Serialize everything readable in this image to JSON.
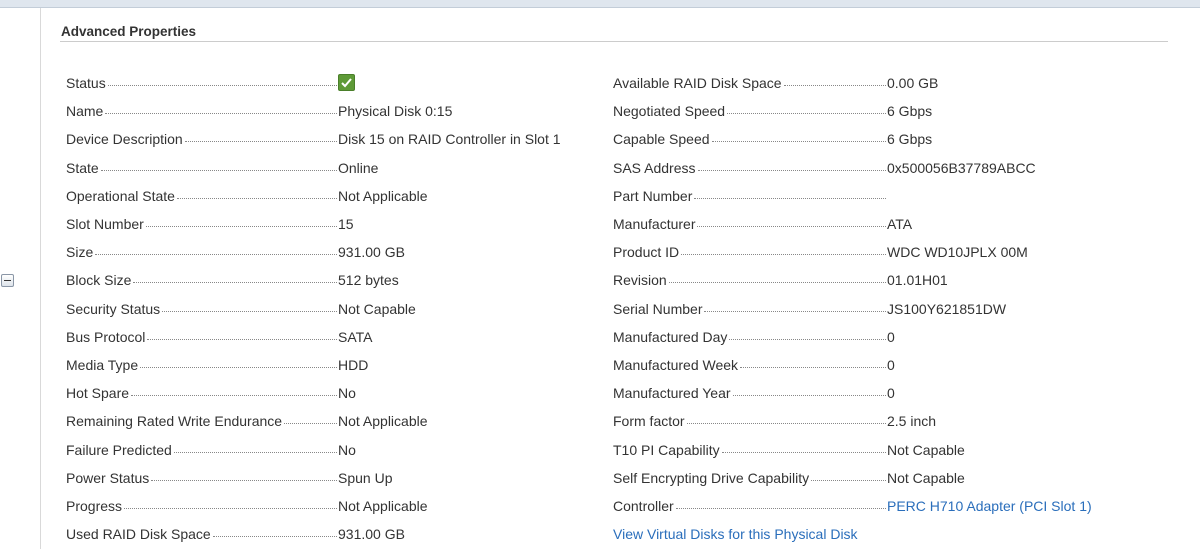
{
  "panel": {
    "title": "Advanced Properties"
  },
  "left": [
    {
      "label": "Status",
      "value": "",
      "status_icon": "check-icon",
      "status_color": "#5e9a37"
    },
    {
      "label": "Name",
      "value": "Physical Disk 0:15"
    },
    {
      "label": "Device Description",
      "value": "Disk 15 on RAID Controller in Slot 1"
    },
    {
      "label": "State",
      "value": "Online"
    },
    {
      "label": "Operational State",
      "value": "Not Applicable"
    },
    {
      "label": "Slot Number",
      "value": "15"
    },
    {
      "label": "Size",
      "value": "931.00 GB"
    },
    {
      "label": "Block Size",
      "value": "512 bytes"
    },
    {
      "label": "Security Status",
      "value": "Not Capable"
    },
    {
      "label": "Bus Protocol",
      "value": "SATA"
    },
    {
      "label": "Media Type",
      "value": "HDD"
    },
    {
      "label": "Hot Spare",
      "value": "No"
    },
    {
      "label": "Remaining Rated Write Endurance",
      "value": "Not Applicable"
    },
    {
      "label": "Failure Predicted",
      "value": "No"
    },
    {
      "label": "Power Status",
      "value": "Spun Up"
    },
    {
      "label": "Progress",
      "value": "Not Applicable"
    },
    {
      "label": "Used RAID Disk Space",
      "value": "931.00 GB"
    }
  ],
  "right": [
    {
      "label": "Available RAID Disk Space",
      "value": "0.00 GB"
    },
    {
      "label": "Negotiated Speed",
      "value": "6 Gbps"
    },
    {
      "label": "Capable Speed",
      "value": "6 Gbps"
    },
    {
      "label": "SAS Address",
      "value": "0x500056B37789ABCC"
    },
    {
      "label": "Part Number",
      "value": ""
    },
    {
      "label": "Manufacturer",
      "value": "ATA"
    },
    {
      "label": "Product ID",
      "value": "WDC WD10JPLX 00M"
    },
    {
      "label": "Revision",
      "value": "01.01H01"
    },
    {
      "label": "Serial Number",
      "value": "JS100Y621851DW"
    },
    {
      "label": "Manufactured Day",
      "value": "0"
    },
    {
      "label": "Manufactured Week",
      "value": "0"
    },
    {
      "label": "Manufactured Year",
      "value": "0"
    },
    {
      "label": "Form factor",
      "value": "2.5 inch"
    },
    {
      "label": "T10 PI Capability",
      "value": "Not Capable"
    },
    {
      "label": "Self Encrypting Drive Capability",
      "value": "Not Capable"
    },
    {
      "label": "Controller",
      "value": "PERC H710 Adapter (PCI Slot 1)",
      "is_link": true
    }
  ],
  "links": {
    "view_virtual_disks": "View Virtual Disks for this Physical Disk"
  },
  "colors": {
    "link": "#2a6ebb",
    "status_ok": "#5e9a37"
  }
}
